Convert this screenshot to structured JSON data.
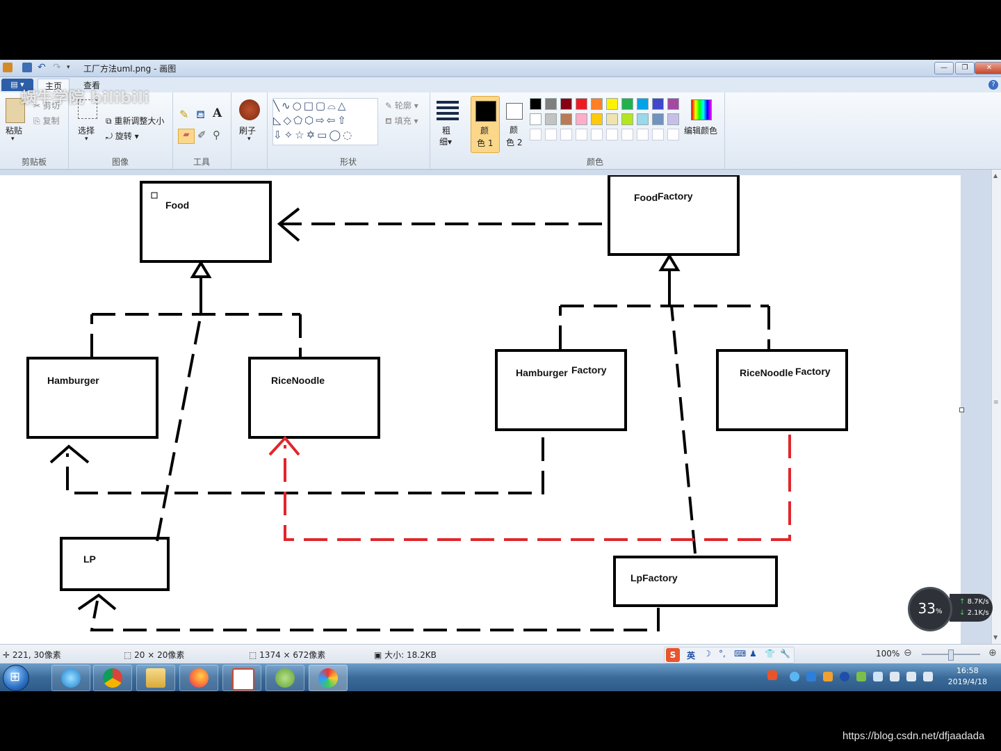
{
  "window": {
    "title": "工厂方法uml.png - 画图",
    "minimize_icon": "minimize-icon",
    "maximize_icon": "maximize-icon",
    "close_icon": "close-icon"
  },
  "tabs": {
    "home": "主页",
    "view": "查看"
  },
  "ribbon": {
    "clipboard": {
      "label": "剪贴板",
      "paste": "粘贴",
      "cut": "剪切",
      "copy": "复制"
    },
    "image": {
      "label": "图像",
      "select": "选择",
      "resize": "重新调整大小",
      "rotate": "旋转"
    },
    "tools": {
      "label": "工具"
    },
    "brushes": {
      "label": "刷子"
    },
    "shapes": {
      "label": "形状",
      "outline": "轮廓",
      "fill": "填充"
    },
    "size": {
      "label_1": "粗",
      "label_2": "细"
    },
    "colors": {
      "label": "颜色",
      "color1_a": "颜",
      "color1_b": "色 1",
      "color2_a": "颜",
      "color2_b": "色 2",
      "edit": "编辑颜色",
      "palette_row1": [
        "#000000",
        "#7f7f7f",
        "#880015",
        "#ed1c24",
        "#ff7f27",
        "#fff200",
        "#22b14c",
        "#00a2e8",
        "#3f48cc",
        "#a349a4"
      ],
      "palette_row2": [
        "#ffffff",
        "#c3c3c3",
        "#b97a57",
        "#ffaec9",
        "#ffc90e",
        "#efe4b0",
        "#b5e61d",
        "#99d9ea",
        "#7092be",
        "#c8bfe7"
      ]
    }
  },
  "diagram": {
    "food": "Food",
    "food_factory_a": "Food",
    "food_factory_b": "Factory",
    "hamburger": "Hamburger",
    "rice_noodle": "RiceNoodle",
    "hamburger_factory_a": "Hamburger",
    "hamburger_factory_b": "Factory",
    "rice_noodle_factory_a": "RiceNoodle",
    "rice_noodle_factory_b": "Factory",
    "lp": "LP",
    "lp_factory": "LpFactory",
    "accent_red": "#e0262b"
  },
  "statusbar": {
    "cursor_pos": "221, 30像素",
    "selection_size": "20 × 20像素",
    "image_size": "1374 × 672像素",
    "file_size": "大小: 18.2KB",
    "zoom": "100%",
    "ime_lang": "英"
  },
  "taskbar": {
    "time": "16:58",
    "date": "2019/4/18"
  },
  "net_widget": {
    "percent": "33",
    "percent_unit": "%",
    "up": "8.7K/s",
    "down": "2.1K/s"
  },
  "overlay": {
    "bilibili": "蜗牛学院 bilibili",
    "watermark": "https://blog.csdn.net/dfjaadada"
  }
}
